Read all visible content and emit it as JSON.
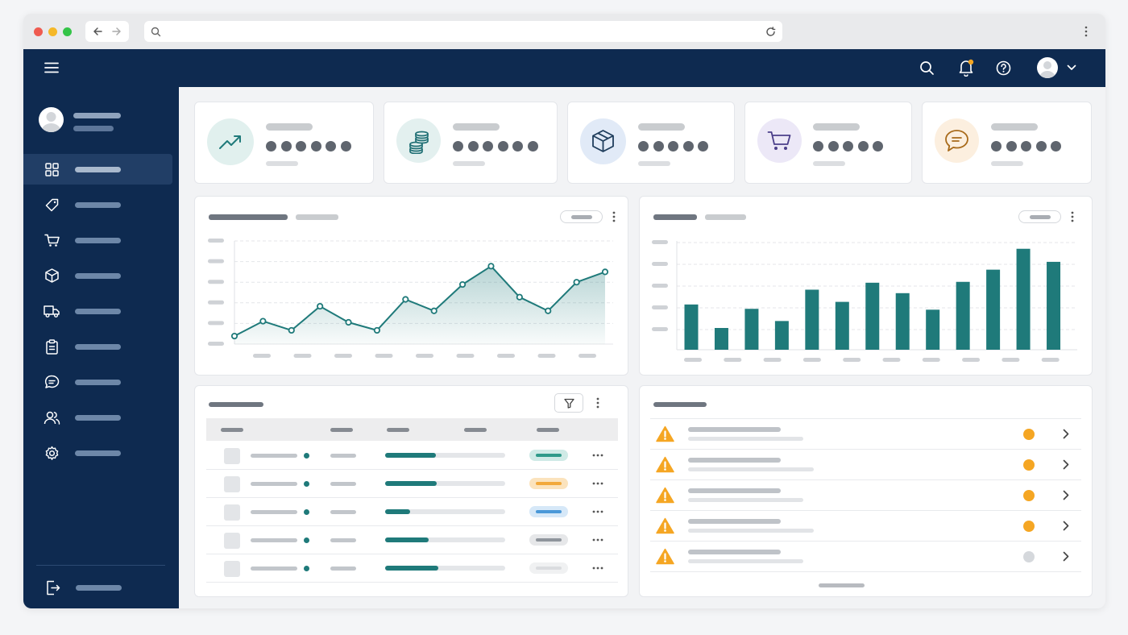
{
  "browser": {
    "traffic_lights": [
      "#ef5b50",
      "#f5b829",
      "#34c448"
    ],
    "url": "",
    "icons": [
      "back-arrow-icon",
      "forward-arrow-icon",
      "search-icon",
      "reload-icon",
      "kebab-menu-icon"
    ]
  },
  "topbar": {
    "icons": [
      "hamburger-menu-icon",
      "search-icon",
      "bell-icon",
      "help-icon",
      "avatar",
      "chevron-down-icon"
    ],
    "notification_dot_color": "#f5a623",
    "background": "#0e2a50"
  },
  "sidebar": {
    "items": [
      {
        "icon": "dashboard-grid-icon",
        "active": true
      },
      {
        "icon": "tag-icon"
      },
      {
        "icon": "cart-icon"
      },
      {
        "icon": "box-icon"
      },
      {
        "icon": "truck-icon"
      },
      {
        "icon": "clipboard-icon"
      },
      {
        "icon": "chat-icon"
      },
      {
        "icon": "users-icon"
      },
      {
        "icon": "gear-icon"
      }
    ],
    "footer_icon": "logout-icon"
  },
  "stat_cards": [
    {
      "icon": "trend-up-icon",
      "icon_bg": "#e1f0ee",
      "icon_color": "#1f7a7a",
      "masked_dots": 6
    },
    {
      "icon": "coins-icon",
      "icon_bg": "#e3f0ef",
      "icon_color": "#1f6f74",
      "masked_dots": 6
    },
    {
      "icon": "box-icon",
      "icon_bg": "#e1eaf7",
      "icon_color": "#1f3d5c",
      "masked_dots": 5
    },
    {
      "icon": "cart-icon",
      "icon_bg": "#ece8f7",
      "icon_color": "#4b3f8a",
      "masked_dots": 5
    },
    {
      "icon": "chat-icon",
      "icon_bg": "#fcefdf",
      "icon_color": "#a86a1a",
      "masked_dots": 5
    }
  ],
  "chart_data": [
    {
      "type": "area",
      "title": "",
      "series": [
        {
          "values": [
            7,
            20,
            12,
            33,
            19,
            12,
            39,
            29,
            52,
            68,
            41,
            29,
            54,
            63
          ]
        }
      ],
      "ylim": [
        0,
        90
      ],
      "grid": true,
      "color": "#1f7a7a"
    },
    {
      "type": "bar",
      "title": "",
      "series": [
        {
          "values": [
            52,
            25,
            47,
            33,
            69,
            55,
            77,
            65,
            46,
            78,
            92,
            116,
            101
          ]
        }
      ],
      "ylim": [
        0,
        125
      ],
      "grid": true,
      "color": "#1f7a7a"
    }
  ],
  "table": {
    "rows": [
      {
        "progress": 0.42,
        "badge_color": "#cfeae6",
        "badge_fill": "#2f9a8a"
      },
      {
        "progress": 0.43,
        "badge_color": "#fbe3bd",
        "badge_fill": "#f2a93b"
      },
      {
        "progress": 0.21,
        "badge_color": "#d6e8f8",
        "badge_fill": "#4a98d8"
      },
      {
        "progress": 0.36,
        "badge_color": "#e6e7e9",
        "badge_fill": "#8f959c"
      },
      {
        "progress": 0.44,
        "badge_color": "#f0f1f2",
        "badge_fill": "#dadcdf"
      }
    ],
    "progress_color": "#1f7a7a",
    "icons": [
      "filter-icon",
      "kebab-menu-icon"
    ]
  },
  "alerts": {
    "rows": [
      {
        "icon": "warning-icon",
        "status_color": "#f5a623"
      },
      {
        "icon": "warning-icon",
        "status_color": "#f5a623"
      },
      {
        "icon": "warning-icon",
        "status_color": "#f5a623"
      },
      {
        "icon": "warning-icon",
        "status_color": "#f5a623"
      },
      {
        "icon": "warning-icon",
        "status_color": "#d5d8dc"
      }
    ],
    "warning_color": "#f5a623"
  }
}
